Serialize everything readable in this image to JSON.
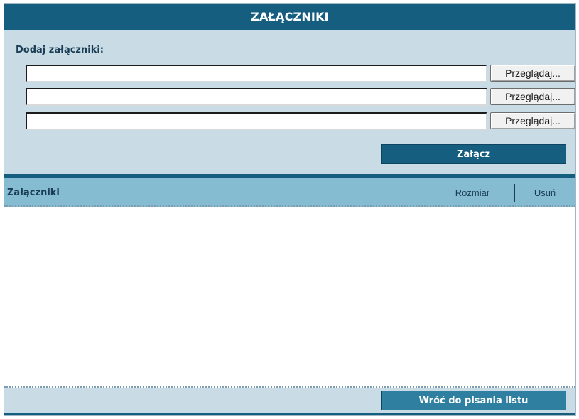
{
  "window": {
    "title": "ZAŁĄCZNIKI"
  },
  "upload": {
    "label": "Dodaj załączniki:",
    "files": [
      {
        "value": "",
        "browse_label": "Przeglądaj..."
      },
      {
        "value": "",
        "browse_label": "Przeglądaj..."
      },
      {
        "value": "",
        "browse_label": "Przeglądaj..."
      }
    ],
    "attach_label": "Załącz"
  },
  "attachments_table": {
    "columns": [
      "Załączniki",
      "Rozmiar",
      "Usuń"
    ],
    "rows": []
  },
  "footer": {
    "back_label": "Wróć do pisania listu"
  },
  "colors": {
    "dark_blue": "#155e80",
    "panel_bg": "#c9dce6",
    "header_bg": "#86bcd1"
  }
}
